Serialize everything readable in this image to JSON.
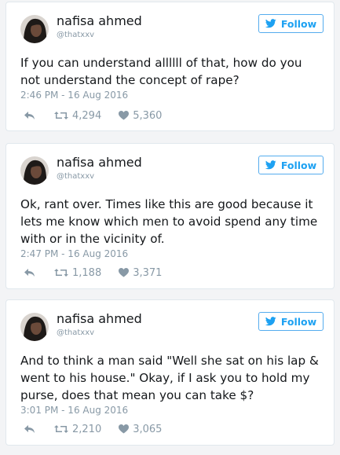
{
  "colors": {
    "accent": "#1da1f2",
    "muted": "#8899a6",
    "text": "#14171a"
  },
  "tweets": [
    {
      "name": "nafisa ahmed",
      "handle": "@thatxxv",
      "follow_label": "Follow",
      "text": "If you can understand allllll of that, how do you not understand the concept of rape?",
      "time": "2:46 PM - 16 Aug 2016",
      "retweets": "4,294",
      "likes": "5,360"
    },
    {
      "name": "nafisa ahmed",
      "handle": "@thatxxv",
      "follow_label": "Follow",
      "text": "Ok, rant over. Times like this are good because it lets me know which men to avoid spend any time with or in the vicinity of.",
      "time": "2:47 PM - 16 Aug 2016",
      "retweets": "1,188",
      "likes": "3,371"
    },
    {
      "name": "nafisa ahmed",
      "handle": "@thatxxv",
      "follow_label": "Follow",
      "text": "And to think a man said \"Well she sat on his lap & went to his house.\" Okay, if I ask you to hold my purse, does that mean you can take $?",
      "time": "3:01 PM - 16 Aug 2016",
      "retweets": "2,210",
      "likes": "3,065"
    }
  ]
}
